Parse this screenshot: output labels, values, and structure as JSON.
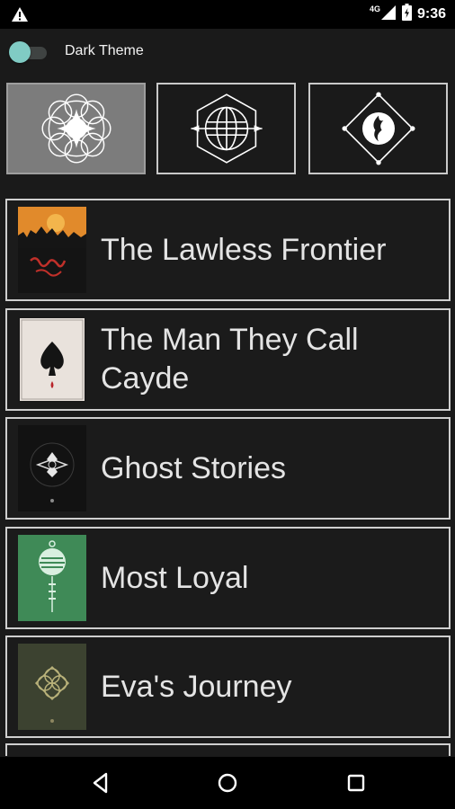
{
  "status_bar": {
    "network": "4G",
    "time": "9:36",
    "icons": [
      "warning-icon",
      "signal-icon",
      "battery-icon"
    ]
  },
  "theme_toggle": {
    "label": "Dark Theme",
    "on": true,
    "color": "#80cbc4"
  },
  "emblem_tabs": [
    {
      "icon": "sunburst-emblem-icon",
      "selected": true
    },
    {
      "icon": "globe-emblem-icon",
      "selected": false
    },
    {
      "icon": "flame-emblem-icon",
      "selected": false
    }
  ],
  "books": [
    {
      "title": "The Lawless Frontier",
      "cover": "lawless-frontier-cover"
    },
    {
      "title": "The Man They Call Cayde",
      "cover": "cayde-spade-cover"
    },
    {
      "title": "Ghost Stories",
      "cover": "ghost-stories-cover"
    },
    {
      "title": "Most Loyal",
      "cover": "most-loyal-cover"
    },
    {
      "title": "Eva's Journey",
      "cover": "evas-journey-cover"
    }
  ],
  "nav": {
    "icons": [
      "back-icon",
      "home-icon",
      "recents-icon"
    ]
  }
}
